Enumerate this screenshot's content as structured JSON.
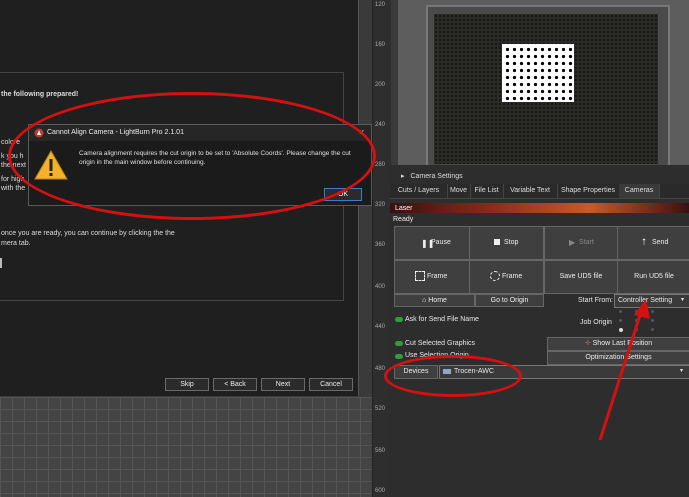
{
  "wizard": {
    "heading": "the following prepared!",
    "fragments": [
      "colore",
      "k you h",
      "the next",
      "for high",
      "with the"
    ],
    "ready_text_line1": "once you are ready, you can continue by clicking the the",
    "ready_text_line2": "mera tab.",
    "buttons": {
      "skip": "Skip",
      "back": "< Back",
      "next": "Next",
      "cancel": "Cancel"
    }
  },
  "alert": {
    "title": "Cannot Align Camera - LightBurn Pro 2.1.01",
    "message": "Camera alignment requires the cut origin to be set to 'Absolute Coords'. Please change the cut origin in the main window before continuing.",
    "ok": "OK",
    "close": "×"
  },
  "ruler": {
    "ticks": [
      "120",
      "160",
      "200",
      "240",
      "280",
      "320",
      "360",
      "400",
      "440",
      "480",
      "520",
      "560",
      "600"
    ]
  },
  "camera_settings": "Camera Settings",
  "tabs": [
    "Cuts / Layers",
    "Move",
    "File List",
    "Variable Text",
    "Shape Properties",
    "Cameras"
  ],
  "laser": {
    "title": "Laser",
    "status": "Ready",
    "buttons": {
      "pause": "Pause",
      "stop": "Stop",
      "start": "Start",
      "send": "Send",
      "frame1": "Frame",
      "frame2": "Frame",
      "save_ud5": "Save UD5 file",
      "run_ud5": "Run UD5 file",
      "home": "Home",
      "go_to_origin": "Go to Origin"
    },
    "start_from_label": "Start From:",
    "start_from_value": "Controller Setting",
    "job_origin_label": "Job Origin",
    "ask_send_label": "Ask for Send File Name",
    "cut_selected_label": "Cut Selected Graphics",
    "use_selection_label": "Use Selection Origin",
    "show_last_label": "Show Last Position",
    "optimization_label": "Optimization Settings",
    "devices_label": "Devices",
    "device_value": "Trocen-AWC"
  }
}
